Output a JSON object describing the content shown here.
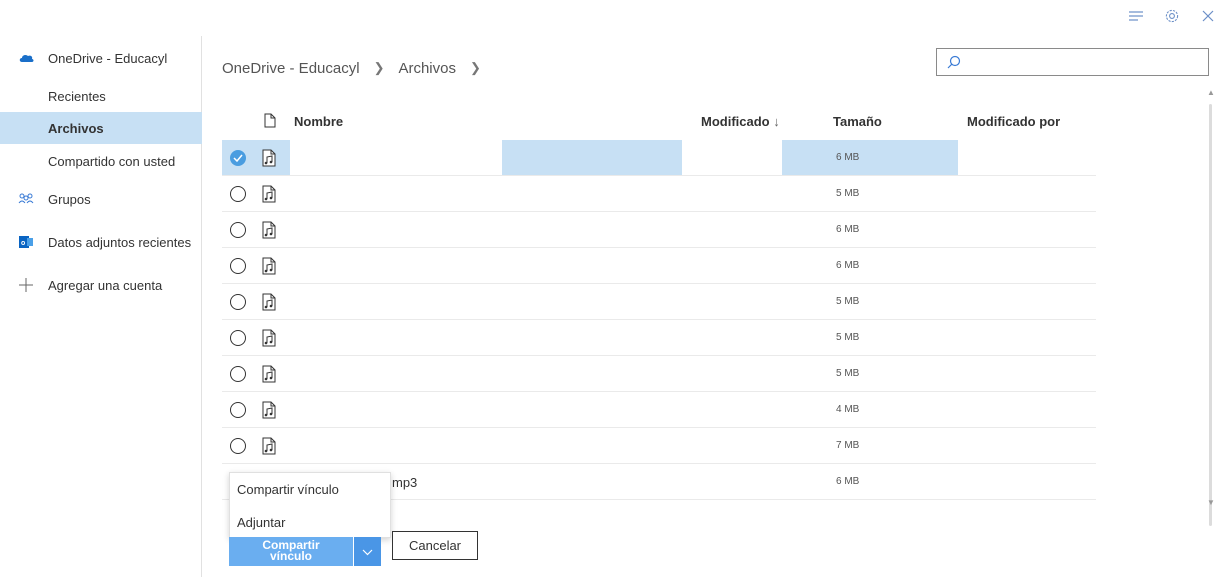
{
  "topbar": {
    "icons": [
      "menu-lines-icon",
      "gear-icon",
      "close-icon"
    ]
  },
  "sidebar": {
    "account": "OneDrive - Educacyl",
    "items": [
      {
        "label": "Recientes"
      },
      {
        "label": "Archivos",
        "active": true
      },
      {
        "label": "Compartido con usted"
      },
      {
        "label": "Grupos",
        "icon": "groups-icon"
      },
      {
        "label": "Datos adjuntos recientes",
        "icon": "outlook-icon"
      },
      {
        "label": "Agregar una cuenta",
        "icon": "plus-icon"
      }
    ]
  },
  "breadcrumb": {
    "root": "OneDrive - Educacyl",
    "current": "Archivos"
  },
  "search": {
    "placeholder": ""
  },
  "columns": {
    "name": "Nombre",
    "modified": "Modificado",
    "sort_indicator": "↓",
    "size": "Tamaño",
    "modified_by": "Modificado por"
  },
  "files": [
    {
      "size": "6 MB",
      "selected": true
    },
    {
      "size": "5 MB"
    },
    {
      "size": "6 MB"
    },
    {
      "size": "6 MB"
    },
    {
      "size": "5 MB"
    },
    {
      "size": "5 MB"
    },
    {
      "size": "5 MB"
    },
    {
      "size": "4 MB"
    },
    {
      "size": "7 MB"
    },
    {
      "size": "6 MB",
      "name_fragment": "mp3"
    }
  ],
  "dropdown": {
    "options": [
      "Compartir vínculo",
      "Adjuntar"
    ]
  },
  "buttons": {
    "primary": "Compartir vínculo",
    "cancel": "Cancelar"
  },
  "colors": {
    "selection": "#c7e0f4",
    "accent": "#4a9de0",
    "primary_button": "#6aaef0"
  }
}
